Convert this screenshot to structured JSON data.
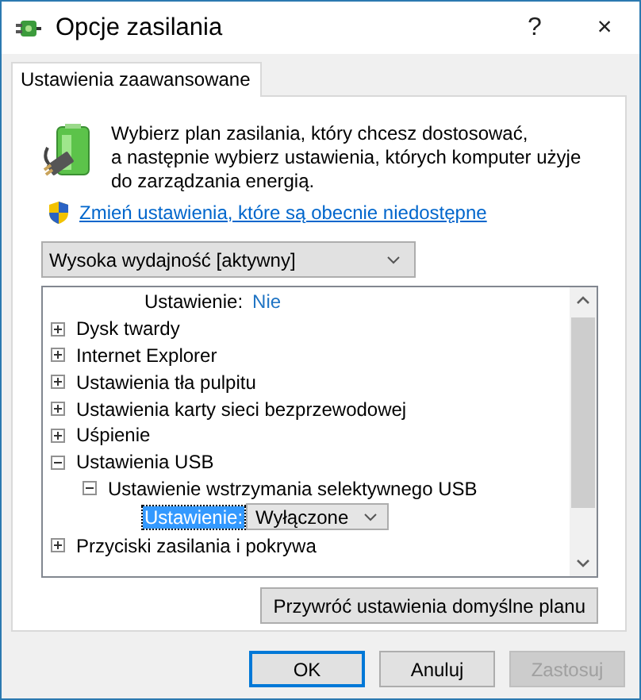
{
  "window": {
    "title": "Opcje zasilania",
    "help": "?",
    "close": "×"
  },
  "tabs": [
    {
      "label": "Ustawienia zaawansowane",
      "selected": true
    }
  ],
  "intro": {
    "lines": [
      "Wybierz plan zasilania, który chcesz dostosować,",
      "a następnie wybierz ustawienia, których komputer użyje",
      "do zarządzania energią."
    ]
  },
  "link": "Zmień ustawienia, które są obecnie niedostępne",
  "plan": {
    "value": "Wysoka wydajność [aktywny]"
  },
  "tree": {
    "items": [
      {
        "kind": "setting",
        "label": "Ustawienie:",
        "value": "Nie",
        "selected": false
      },
      {
        "kind": "group",
        "label": "Dysk twardy",
        "expanded": false
      },
      {
        "kind": "group",
        "label": "Internet Explorer",
        "expanded": false
      },
      {
        "kind": "group",
        "label": "Ustawienia tła pulpitu",
        "expanded": false
      },
      {
        "kind": "group",
        "label": "Ustawienia karty sieci bezprzewodowej",
        "expanded": false
      },
      {
        "kind": "group",
        "label": "Uśpienie",
        "expanded": false
      },
      {
        "kind": "group",
        "label": "Ustawienia USB",
        "expanded": true,
        "children": [
          {
            "kind": "group",
            "label": "Ustawienie wstrzymania selektywnego USB",
            "expanded": true,
            "children": [
              {
                "kind": "setting",
                "label": "Ustawienie:",
                "value": "Wyłączone",
                "selected": true
              }
            ]
          }
        ]
      },
      {
        "kind": "group",
        "label": "Przyciski zasilania i pokrywa",
        "expanded": false
      }
    ]
  },
  "restore_button": "Przywróć ustawienia domyślne planu",
  "buttons": [
    {
      "label": "OK",
      "default": true,
      "disabled": false
    },
    {
      "label": "Anuluj",
      "default": false,
      "disabled": false
    },
    {
      "label": "Zastosuj",
      "default": false,
      "disabled": true
    }
  ]
}
